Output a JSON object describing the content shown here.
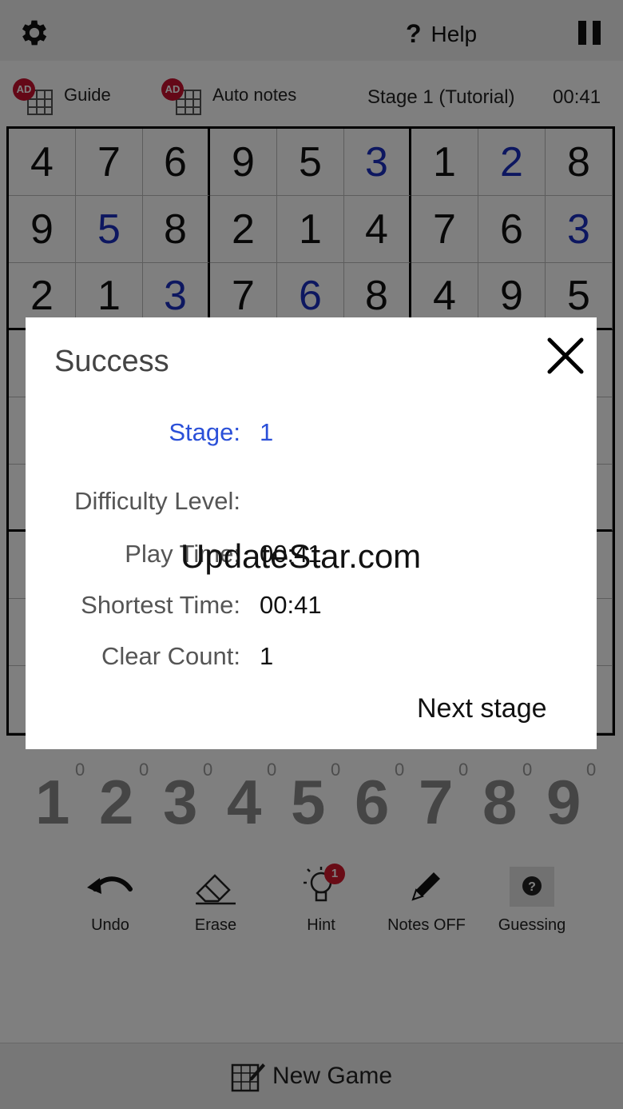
{
  "header": {
    "help_glyph": "?",
    "help_label": "Help",
    "icons": [
      "gear-icon",
      "help-icon",
      "pause-icon"
    ]
  },
  "tools": {
    "ad_badge": "AD",
    "guide_label": "Guide",
    "auto_notes_label": "Auto notes",
    "stage_label": "Stage 1 (Tutorial)",
    "timer": "00:41"
  },
  "board": {
    "rows": [
      [
        {
          "v": "4",
          "t": "given"
        },
        {
          "v": "7",
          "t": "given"
        },
        {
          "v": "6",
          "t": "given"
        },
        {
          "v": "9",
          "t": "given"
        },
        {
          "v": "5",
          "t": "given"
        },
        {
          "v": "3",
          "t": "user"
        },
        {
          "v": "1",
          "t": "given"
        },
        {
          "v": "2",
          "t": "user"
        },
        {
          "v": "8",
          "t": "given"
        }
      ],
      [
        {
          "v": "9",
          "t": "given"
        },
        {
          "v": "5",
          "t": "user"
        },
        {
          "v": "8",
          "t": "given"
        },
        {
          "v": "2",
          "t": "given"
        },
        {
          "v": "1",
          "t": "given"
        },
        {
          "v": "4",
          "t": "given"
        },
        {
          "v": "7",
          "t": "given"
        },
        {
          "v": "6",
          "t": "given"
        },
        {
          "v": "3",
          "t": "user"
        }
      ],
      [
        {
          "v": "2",
          "t": "given"
        },
        {
          "v": "1",
          "t": "given"
        },
        {
          "v": "3",
          "t": "user"
        },
        {
          "v": "7",
          "t": "given"
        },
        {
          "v": "6",
          "t": "user"
        },
        {
          "v": "8",
          "t": "given"
        },
        {
          "v": "4",
          "t": "given"
        },
        {
          "v": "9",
          "t": "given"
        },
        {
          "v": "5",
          "t": "given"
        }
      ],
      [
        {
          "v": "",
          "t": "given"
        },
        {
          "v": "",
          "t": "given"
        },
        {
          "v": "",
          "t": "given"
        },
        {
          "v": "",
          "t": "given"
        },
        {
          "v": "",
          "t": "given"
        },
        {
          "v": "",
          "t": "given"
        },
        {
          "v": "",
          "t": "given"
        },
        {
          "v": "",
          "t": "given"
        },
        {
          "v": "",
          "t": "given"
        }
      ],
      [
        {
          "v": "",
          "t": "given"
        },
        {
          "v": "",
          "t": "given"
        },
        {
          "v": "",
          "t": "given"
        },
        {
          "v": "",
          "t": "given"
        },
        {
          "v": "",
          "t": "given"
        },
        {
          "v": "",
          "t": "given"
        },
        {
          "v": "",
          "t": "given"
        },
        {
          "v": "",
          "t": "given"
        },
        {
          "v": "",
          "t": "given"
        }
      ],
      [
        {
          "v": "",
          "t": "given"
        },
        {
          "v": "",
          "t": "given"
        },
        {
          "v": "",
          "t": "given"
        },
        {
          "v": "",
          "t": "given"
        },
        {
          "v": "",
          "t": "given"
        },
        {
          "v": "",
          "t": "given"
        },
        {
          "v": "",
          "t": "given"
        },
        {
          "v": "",
          "t": "given"
        },
        {
          "v": "",
          "t": "given"
        }
      ],
      [
        {
          "v": "",
          "t": "given"
        },
        {
          "v": "",
          "t": "given"
        },
        {
          "v": "",
          "t": "given"
        },
        {
          "v": "",
          "t": "given"
        },
        {
          "v": "",
          "t": "given"
        },
        {
          "v": "",
          "t": "given"
        },
        {
          "v": "",
          "t": "given"
        },
        {
          "v": "",
          "t": "given"
        },
        {
          "v": "",
          "t": "given"
        }
      ],
      [
        {
          "v": "",
          "t": "given"
        },
        {
          "v": "",
          "t": "given"
        },
        {
          "v": "",
          "t": "given"
        },
        {
          "v": "",
          "t": "given"
        },
        {
          "v": "",
          "t": "given"
        },
        {
          "v": "",
          "t": "given"
        },
        {
          "v": "",
          "t": "given"
        },
        {
          "v": "",
          "t": "given"
        },
        {
          "v": "",
          "t": "given"
        }
      ],
      [
        {
          "v": "",
          "t": "given"
        },
        {
          "v": "",
          "t": "given"
        },
        {
          "v": "",
          "t": "given"
        },
        {
          "v": "",
          "t": "given"
        },
        {
          "v": "",
          "t": "given"
        },
        {
          "v": "",
          "t": "given"
        },
        {
          "v": "",
          "t": "given"
        },
        {
          "v": "",
          "t": "given"
        },
        {
          "v": "",
          "t": "given"
        }
      ]
    ]
  },
  "numpad": [
    {
      "digit": "1",
      "count": "0"
    },
    {
      "digit": "2",
      "count": "0"
    },
    {
      "digit": "3",
      "count": "0"
    },
    {
      "digit": "4",
      "count": "0"
    },
    {
      "digit": "5",
      "count": "0"
    },
    {
      "digit": "6",
      "count": "0"
    },
    {
      "digit": "7",
      "count": "0"
    },
    {
      "digit": "8",
      "count": "0"
    },
    {
      "digit": "9",
      "count": "0"
    }
  ],
  "actions": {
    "undo_label": "Undo",
    "erase_label": "Erase",
    "hint_label": "Hint",
    "hint_badge": "1",
    "notes_label": "Notes OFF",
    "guessing_label": "Guessing",
    "guessing_glyph": "?"
  },
  "bottom": {
    "new_game_label": "New Game"
  },
  "dialog": {
    "title": "Success",
    "stage_key": "Stage:",
    "stage_val": "1",
    "difficulty_key": "Difficulty Level:",
    "difficulty_val": "",
    "play_time_key": "Play Time:",
    "play_time_val": "00:41",
    "shortest_key": "Shortest Time:",
    "shortest_val": "00:41",
    "clear_key": "Clear Count:",
    "clear_val": "1",
    "next_label": "Next stage"
  },
  "watermark": "UpdateStar.com",
  "colors": {
    "user_digit": "#1a2fc0",
    "dialog_stage": "#2b50d8",
    "badge_red": "#c8102e"
  }
}
